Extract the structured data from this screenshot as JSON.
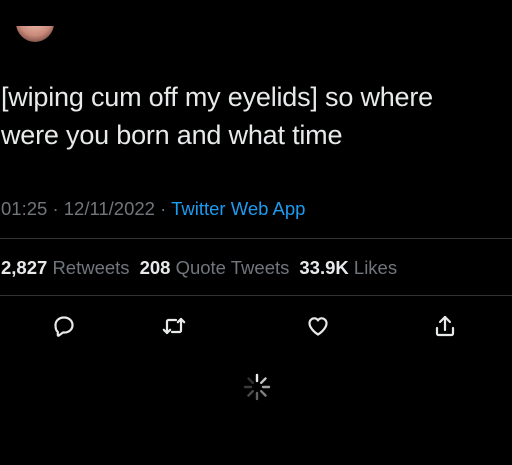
{
  "tweet": {
    "text_lines": [
      "[wiping cum off my eyelids] so where",
      "were you born and what time"
    ],
    "time": "01:25",
    "separator": "·",
    "date": "12/11/2022",
    "source": "Twitter Web App"
  },
  "stats": {
    "retweets_count": "2,827",
    "retweets_label": "Retweets",
    "quote_count": "208",
    "quote_label": "Quote Tweets",
    "likes_count": "33.9K",
    "likes_label": "Likes"
  },
  "actions": [
    {
      "icon": "reply-icon"
    },
    {
      "icon": "retweet-icon"
    },
    {
      "icon": "like-icon"
    },
    {
      "icon": "share-icon"
    }
  ],
  "colors": {
    "background": "#000000",
    "text": "#e7e9ea",
    "muted": "#71767b",
    "link": "#1d9bf0",
    "divider": "#2f3336"
  }
}
